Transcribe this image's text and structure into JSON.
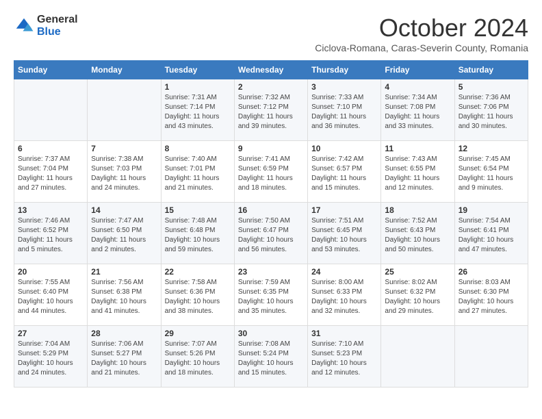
{
  "logo": {
    "general": "General",
    "blue": "Blue"
  },
  "title": "October 2024",
  "subtitle": "Ciclova-Romana, Caras-Severin County, Romania",
  "weekdays": [
    "Sunday",
    "Monday",
    "Tuesday",
    "Wednesday",
    "Thursday",
    "Friday",
    "Saturday"
  ],
  "weeks": [
    [
      {
        "day": "",
        "info": ""
      },
      {
        "day": "",
        "info": ""
      },
      {
        "day": "1",
        "info": "Sunrise: 7:31 AM\nSunset: 7:14 PM\nDaylight: 11 hours and 43 minutes."
      },
      {
        "day": "2",
        "info": "Sunrise: 7:32 AM\nSunset: 7:12 PM\nDaylight: 11 hours and 39 minutes."
      },
      {
        "day": "3",
        "info": "Sunrise: 7:33 AM\nSunset: 7:10 PM\nDaylight: 11 hours and 36 minutes."
      },
      {
        "day": "4",
        "info": "Sunrise: 7:34 AM\nSunset: 7:08 PM\nDaylight: 11 hours and 33 minutes."
      },
      {
        "day": "5",
        "info": "Sunrise: 7:36 AM\nSunset: 7:06 PM\nDaylight: 11 hours and 30 minutes."
      }
    ],
    [
      {
        "day": "6",
        "info": "Sunrise: 7:37 AM\nSunset: 7:04 PM\nDaylight: 11 hours and 27 minutes."
      },
      {
        "day": "7",
        "info": "Sunrise: 7:38 AM\nSunset: 7:03 PM\nDaylight: 11 hours and 24 minutes."
      },
      {
        "day": "8",
        "info": "Sunrise: 7:40 AM\nSunset: 7:01 PM\nDaylight: 11 hours and 21 minutes."
      },
      {
        "day": "9",
        "info": "Sunrise: 7:41 AM\nSunset: 6:59 PM\nDaylight: 11 hours and 18 minutes."
      },
      {
        "day": "10",
        "info": "Sunrise: 7:42 AM\nSunset: 6:57 PM\nDaylight: 11 hours and 15 minutes."
      },
      {
        "day": "11",
        "info": "Sunrise: 7:43 AM\nSunset: 6:55 PM\nDaylight: 11 hours and 12 minutes."
      },
      {
        "day": "12",
        "info": "Sunrise: 7:45 AM\nSunset: 6:54 PM\nDaylight: 11 hours and 9 minutes."
      }
    ],
    [
      {
        "day": "13",
        "info": "Sunrise: 7:46 AM\nSunset: 6:52 PM\nDaylight: 11 hours and 5 minutes."
      },
      {
        "day": "14",
        "info": "Sunrise: 7:47 AM\nSunset: 6:50 PM\nDaylight: 11 hours and 2 minutes."
      },
      {
        "day": "15",
        "info": "Sunrise: 7:48 AM\nSunset: 6:48 PM\nDaylight: 10 hours and 59 minutes."
      },
      {
        "day": "16",
        "info": "Sunrise: 7:50 AM\nSunset: 6:47 PM\nDaylight: 10 hours and 56 minutes."
      },
      {
        "day": "17",
        "info": "Sunrise: 7:51 AM\nSunset: 6:45 PM\nDaylight: 10 hours and 53 minutes."
      },
      {
        "day": "18",
        "info": "Sunrise: 7:52 AM\nSunset: 6:43 PM\nDaylight: 10 hours and 50 minutes."
      },
      {
        "day": "19",
        "info": "Sunrise: 7:54 AM\nSunset: 6:41 PM\nDaylight: 10 hours and 47 minutes."
      }
    ],
    [
      {
        "day": "20",
        "info": "Sunrise: 7:55 AM\nSunset: 6:40 PM\nDaylight: 10 hours and 44 minutes."
      },
      {
        "day": "21",
        "info": "Sunrise: 7:56 AM\nSunset: 6:38 PM\nDaylight: 10 hours and 41 minutes."
      },
      {
        "day": "22",
        "info": "Sunrise: 7:58 AM\nSunset: 6:36 PM\nDaylight: 10 hours and 38 minutes."
      },
      {
        "day": "23",
        "info": "Sunrise: 7:59 AM\nSunset: 6:35 PM\nDaylight: 10 hours and 35 minutes."
      },
      {
        "day": "24",
        "info": "Sunrise: 8:00 AM\nSunset: 6:33 PM\nDaylight: 10 hours and 32 minutes."
      },
      {
        "day": "25",
        "info": "Sunrise: 8:02 AM\nSunset: 6:32 PM\nDaylight: 10 hours and 29 minutes."
      },
      {
        "day": "26",
        "info": "Sunrise: 8:03 AM\nSunset: 6:30 PM\nDaylight: 10 hours and 27 minutes."
      }
    ],
    [
      {
        "day": "27",
        "info": "Sunrise: 7:04 AM\nSunset: 5:29 PM\nDaylight: 10 hours and 24 minutes."
      },
      {
        "day": "28",
        "info": "Sunrise: 7:06 AM\nSunset: 5:27 PM\nDaylight: 10 hours and 21 minutes."
      },
      {
        "day": "29",
        "info": "Sunrise: 7:07 AM\nSunset: 5:26 PM\nDaylight: 10 hours and 18 minutes."
      },
      {
        "day": "30",
        "info": "Sunrise: 7:08 AM\nSunset: 5:24 PM\nDaylight: 10 hours and 15 minutes."
      },
      {
        "day": "31",
        "info": "Sunrise: 7:10 AM\nSunset: 5:23 PM\nDaylight: 10 hours and 12 minutes."
      },
      {
        "day": "",
        "info": ""
      },
      {
        "day": "",
        "info": ""
      }
    ]
  ]
}
